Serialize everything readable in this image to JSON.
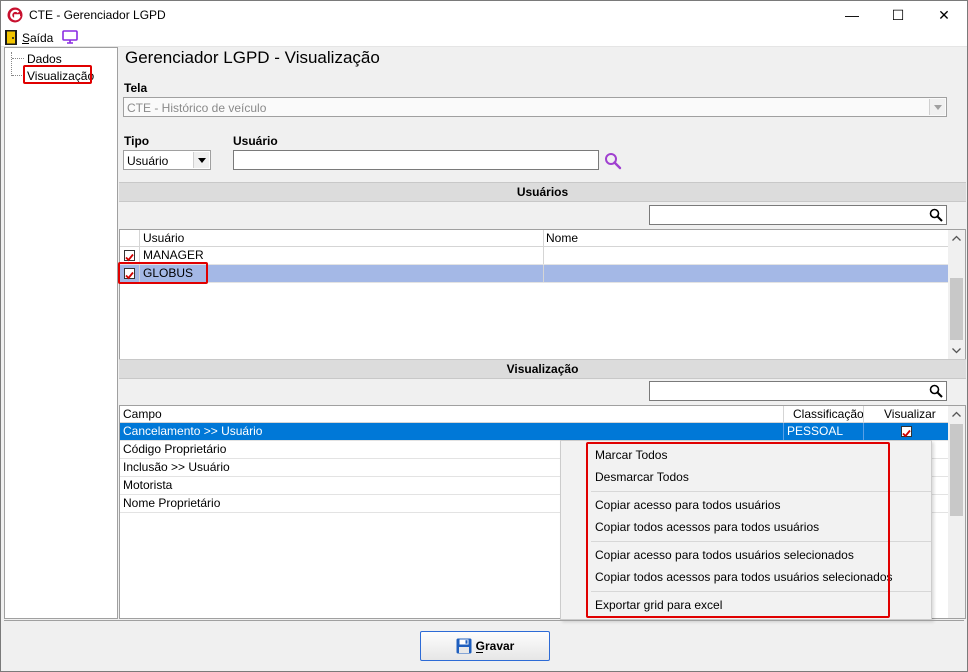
{
  "window": {
    "title": "CTE - Gerenciador LGPD",
    "minimize_glyph": "—",
    "maximize_glyph": "☐",
    "close_glyph": "✕"
  },
  "menubar": {
    "saida": "Saída"
  },
  "tree": {
    "items": [
      {
        "label": "Dados"
      },
      {
        "label": "Visualização"
      }
    ]
  },
  "page": {
    "title": "Gerenciador LGPD - Visualização"
  },
  "tela": {
    "label": "Tela",
    "value": "CTE - Histórico de veículo"
  },
  "tipo": {
    "label": "Tipo",
    "value": "Usuário"
  },
  "usuario": {
    "label": "Usuário",
    "value": ""
  },
  "usuarios_section": {
    "title": "Usuários",
    "columns": [
      "Usuário",
      "Nome"
    ],
    "rows": [
      {
        "usuario": "MANAGER",
        "nome": "",
        "checked": true
      },
      {
        "usuario": "GLOBUS",
        "nome": "",
        "checked": true
      }
    ]
  },
  "visualizacao_section": {
    "title": "Visualização",
    "columns": [
      "Campo",
      "Classificação",
      "Visualizar"
    ],
    "rows": [
      {
        "campo": "Cancelamento >> Usuário",
        "classificacao": "PESSOAL",
        "visualizar": true
      },
      {
        "campo": "Código Proprietário",
        "classificacao": "",
        "visualizar": false
      },
      {
        "campo": "Inclusão >> Usuário",
        "classificacao": "",
        "visualizar": false
      },
      {
        "campo": "Motorista",
        "classificacao": "",
        "visualizar": false
      },
      {
        "campo": "Nome Proprietário",
        "classificacao": "",
        "visualizar": false
      }
    ]
  },
  "context_menu": {
    "items": [
      "Marcar Todos",
      "Desmarcar Todos",
      "Copiar acesso para todos usuários",
      "Copiar todos acessos para todos usuários",
      "Copiar acesso para todos usuários selecionados",
      "Copiar todos acessos para todos usuários selecionados",
      "Exportar grid para excel"
    ]
  },
  "buttons": {
    "gravar": "Gravar"
  },
  "icons": [
    "app-logo-icon",
    "exit-icon",
    "monitor-icon",
    "search-icon",
    "save-disk-icon",
    "checkbox-checked-icon",
    "dropdown-arrow-icon"
  ],
  "colors": {
    "selected_row": "#0078d7",
    "highlight_row": "#a4b8e6",
    "annotation_red": "#e00000",
    "check_red": "#d00000"
  }
}
